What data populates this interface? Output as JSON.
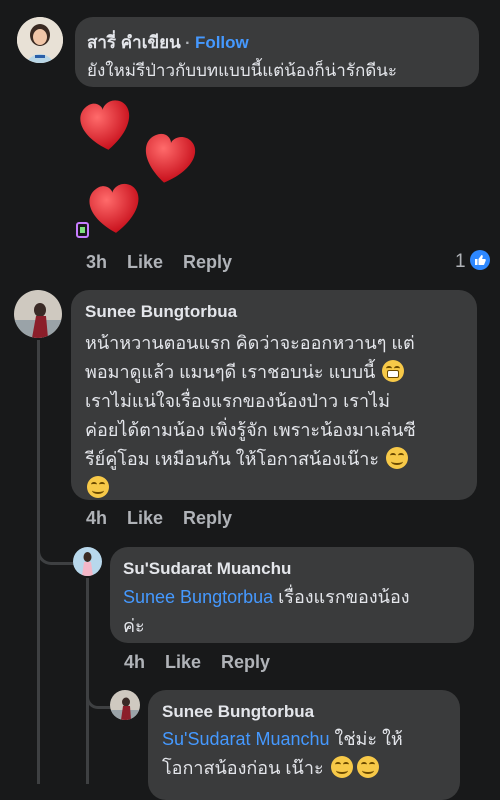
{
  "comment1": {
    "author": "สารี่ คำเขียน",
    "separator": " · ",
    "follow_label": "Follow",
    "text": "ยังใหม่รีป่าวกับบทแบบนี้แต่น้องก็น่ารักดีนะ",
    "time": "3h",
    "like_label": "Like",
    "reply_label": "Reply",
    "reaction_count": "1"
  },
  "comment2": {
    "author": "Sunee Bungtorbua",
    "lines": [
      "หน้าหวานตอนแรก คิดว่าจะออกหวานๆ แต่",
      "พอมาดูแล้ว แมนๆดี เราชอบน่ะ แบบนี้",
      "เราไม่แน่ใจเรื่องแรกของน้องป่าว  เราไม่",
      "ค่อยได้ตามน้อง เพิ่งรู้จัก เพราะน้องมาเล่นซี",
      "รีย์คู่โอม เหมือนกัน  ให้โอกาสน้องเน๊าะ"
    ],
    "time": "4h",
    "like_label": "Like",
    "reply_label": "Reply"
  },
  "reply1": {
    "author": "Su'Sudarat Muanchu",
    "mention": "Sunee Bungtorbua",
    "text1": " เรื่องแรกของน้อง",
    "text2": "ค่ะ",
    "time": "4h",
    "like_label": "Like",
    "reply_label": "Reply"
  },
  "reply2": {
    "author": "Sunee Bungtorbua",
    "mention": "Su'Sudarat Muanchu",
    "text1": " ใช่ม่ะ ให้",
    "text2": "โอกาสน้องก่อน เน๊าะ"
  },
  "colors": {
    "background": "#18191a",
    "bubble": "#3a3b3c",
    "link": "#4599ff",
    "heart": "#e0242d",
    "reaction": "#2d88ff"
  },
  "icons": {
    "hearts": "heart-sticker",
    "emoji_smile": "smiling-face-emoji",
    "emoji_grin": "grimacing-face-emoji",
    "like_reaction": "thumbs-up-icon"
  }
}
